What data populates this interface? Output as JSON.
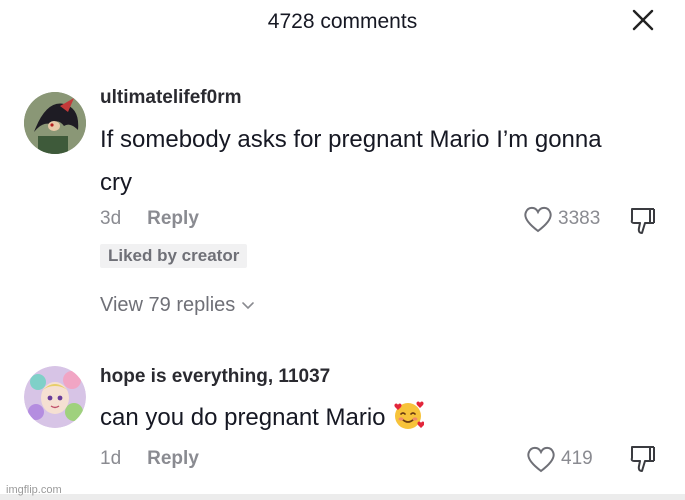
{
  "header": {
    "title": "4728 comments",
    "close_icon": "close-icon"
  },
  "comments": [
    {
      "username": "ultimatelifef0rm",
      "text": "If somebody asks for pregnant Mario I’m gonna cry",
      "age": "3d",
      "reply_label": "Reply",
      "likes": "3383",
      "badge": "Liked by creator",
      "view_replies": "View 79 replies",
      "avatar_icon": "shadow-hedgehog-avatar"
    },
    {
      "username": "hope is everything, 11037",
      "text": "can you do pregnant Mario",
      "emoji": "smiling-face-with-hearts-emoji",
      "age": "1d",
      "reply_label": "Reply",
      "likes": "419",
      "avatar_icon": "anime-character-avatar"
    }
  ],
  "watermark": "imgflip.com",
  "colors": {
    "text_primary": "#161823",
    "text_secondary": "#8a8b91",
    "badge_bg": "#f1f1f2"
  }
}
